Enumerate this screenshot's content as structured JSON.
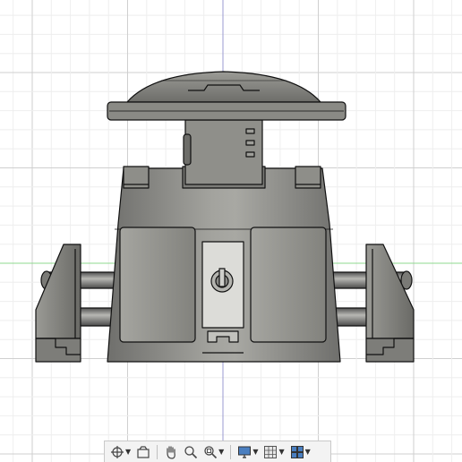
{
  "app": "3D CAD viewport",
  "colors": {
    "grid_minor": "#eeeeee",
    "grid_major": "#cfcfcf",
    "axis_vertical": "#9a9ad0",
    "axis_horizontal": "#8fd88f",
    "model_dark": "#6e6e6b",
    "model_mid": "#8d8d88",
    "model_light": "#b5b5b0",
    "edge": "#111111",
    "toolbar_bg": "#f3f3f3"
  },
  "toolbar": {
    "items": [
      {
        "icon": "orbit-icon",
        "has_dropdown": true
      },
      {
        "icon": "look-at-icon",
        "has_dropdown": false
      },
      {
        "icon": "pan-hand-icon",
        "has_dropdown": false
      },
      {
        "icon": "zoom-icon",
        "has_dropdown": false
      },
      {
        "icon": "fit-zoom-icon",
        "has_dropdown": true
      },
      {
        "icon": "display-settings-icon",
        "has_dropdown": true
      },
      {
        "icon": "grid-settings-icon",
        "has_dropdown": true
      },
      {
        "icon": "viewports-icon",
        "has_dropdown": true
      }
    ]
  }
}
